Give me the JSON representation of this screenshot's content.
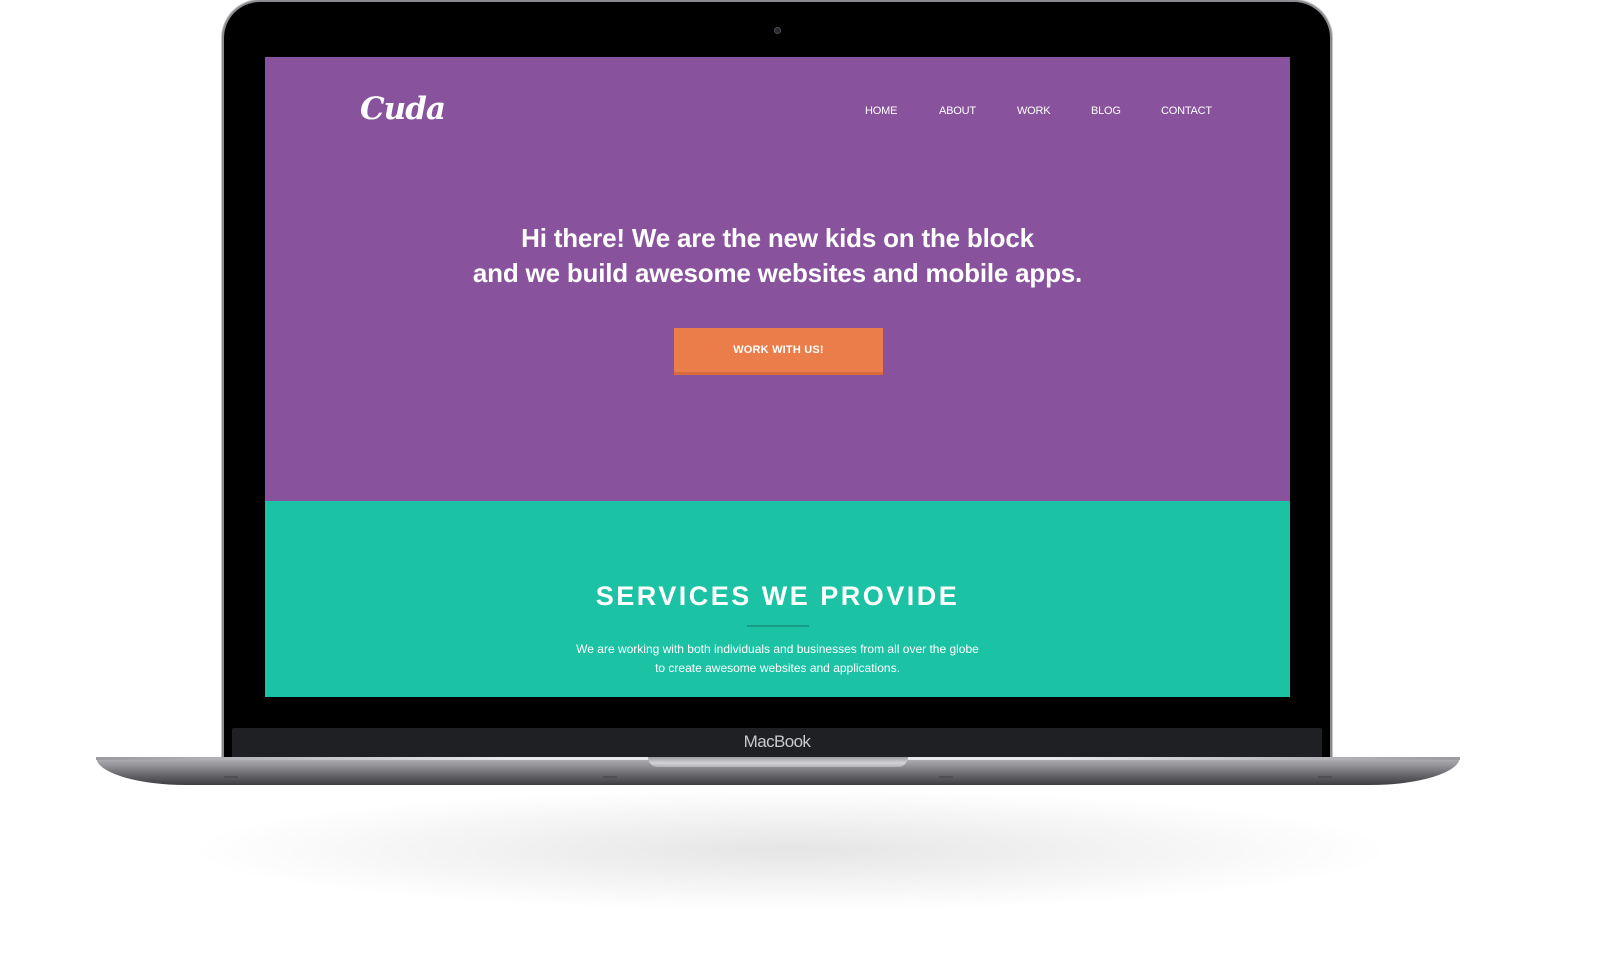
{
  "device": {
    "brand_label": "MacBook"
  },
  "site": {
    "logo_text": "Cuda",
    "nav": [
      {
        "label": "HOME"
      },
      {
        "label": "ABOUT"
      },
      {
        "label": "WORK"
      },
      {
        "label": "BLOG"
      },
      {
        "label": "CONTACT"
      }
    ],
    "hero": {
      "headline_line1": "Hi there! We are the new kids on the block",
      "headline_line2": "and we build awesome websites and mobile apps.",
      "cta_label": "WORK WITH US!"
    },
    "services": {
      "title": "SERVICES WE PROVIDE",
      "text_line1": "We are working with both individuals and businesses from all over the globe",
      "text_line2": "to create awesome websites and applications."
    }
  },
  "colors": {
    "hero_background": "#88529d",
    "services_background": "#1bc3a4",
    "cta_background": "#eb7d4b",
    "text": "#ffffff"
  }
}
